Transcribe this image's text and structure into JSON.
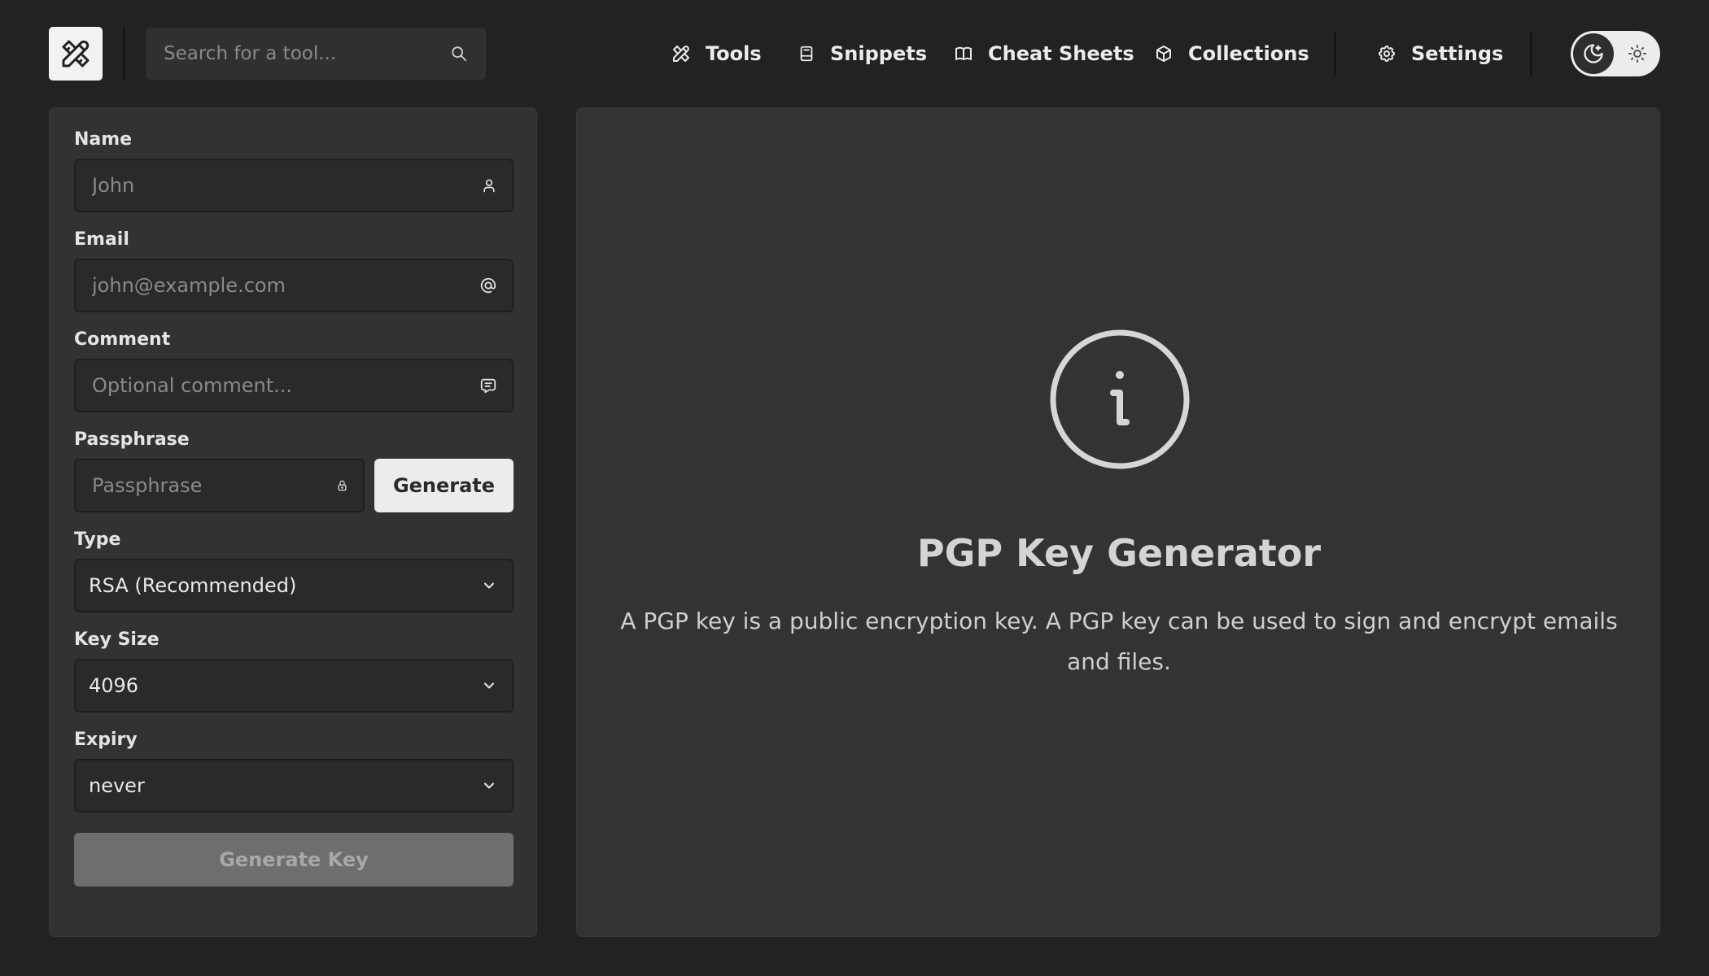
{
  "header": {
    "logo_icon": "tools-icon",
    "search": {
      "placeholder": "Search for a tool..."
    },
    "nav": [
      {
        "label": "Tools",
        "icon": "tools-icon"
      },
      {
        "label": "Snippets",
        "icon": "notebook-icon"
      },
      {
        "label": "Cheat Sheets",
        "icon": "book-icon"
      },
      {
        "label": "Collections",
        "icon": "box-icon"
      }
    ],
    "settings": {
      "label": "Settings",
      "icon": "gear-icon"
    },
    "theme_toggle": {
      "selected": "dark",
      "options": [
        "dark",
        "light"
      ]
    }
  },
  "form": {
    "name": {
      "label": "Name",
      "placeholder": "John",
      "value": ""
    },
    "email": {
      "label": "Email",
      "placeholder": "john@example.com",
      "value": ""
    },
    "comment": {
      "label": "Comment",
      "placeholder": "Optional comment...",
      "value": ""
    },
    "passphrase": {
      "label": "Passphrase",
      "placeholder": "Passphrase",
      "value": "",
      "generate_label": "Generate"
    },
    "type": {
      "label": "Type",
      "value": "RSA (Recommended)"
    },
    "key_size": {
      "label": "Key Size",
      "value": "4096"
    },
    "expiry": {
      "label": "Expiry",
      "value": "never"
    },
    "submit_label": "Generate Key"
  },
  "result": {
    "title": "PGP Key Generator",
    "description": "A PGP key is a public encryption key. A PGP key can be used to sign and encrypt emails and files."
  },
  "colors": {
    "background": "#222222",
    "panel": "#333333",
    "accent_light": "#ececec",
    "disabled_button": "#6e6e6e"
  }
}
